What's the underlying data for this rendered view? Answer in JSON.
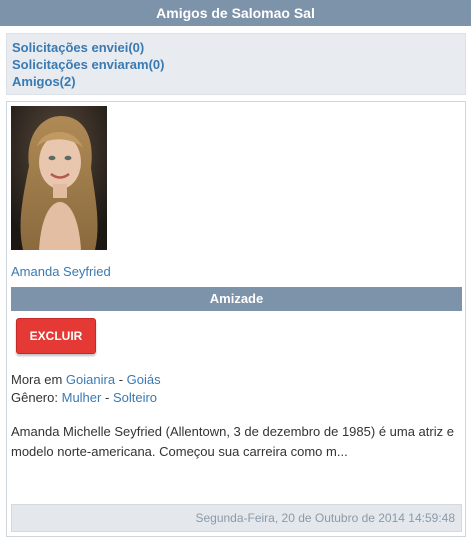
{
  "page": {
    "title": "Amigos de Salomao Sal"
  },
  "nav": {
    "sent": "Solicitações enviei(0)",
    "received": "Solicitações enviaram(0)",
    "friends": "Amigos(2)"
  },
  "friend": {
    "name": "Amanda Seyfried",
    "section_title": "Amizade",
    "remove_label": "EXCLUIR",
    "lives_prefix": "Mora em",
    "city": "Goianira",
    "location_sep": "-",
    "state": "Goiás",
    "gender_prefix": "Gênero:",
    "gender": "Mulher",
    "status_sep": "-",
    "status": "Solteiro",
    "description": "Amanda Michelle Seyfried (Allentown, 3 de dezembro de 1985) é uma atriz e modelo norte-americana. Começou sua carreira como m...",
    "date": "Segunda-Feira, 20 de Outubro de 2014 14:59:48"
  },
  "colors": {
    "header_bg": "#7d93aa",
    "link": "#3a7ab3",
    "danger_button": "#e53935"
  }
}
